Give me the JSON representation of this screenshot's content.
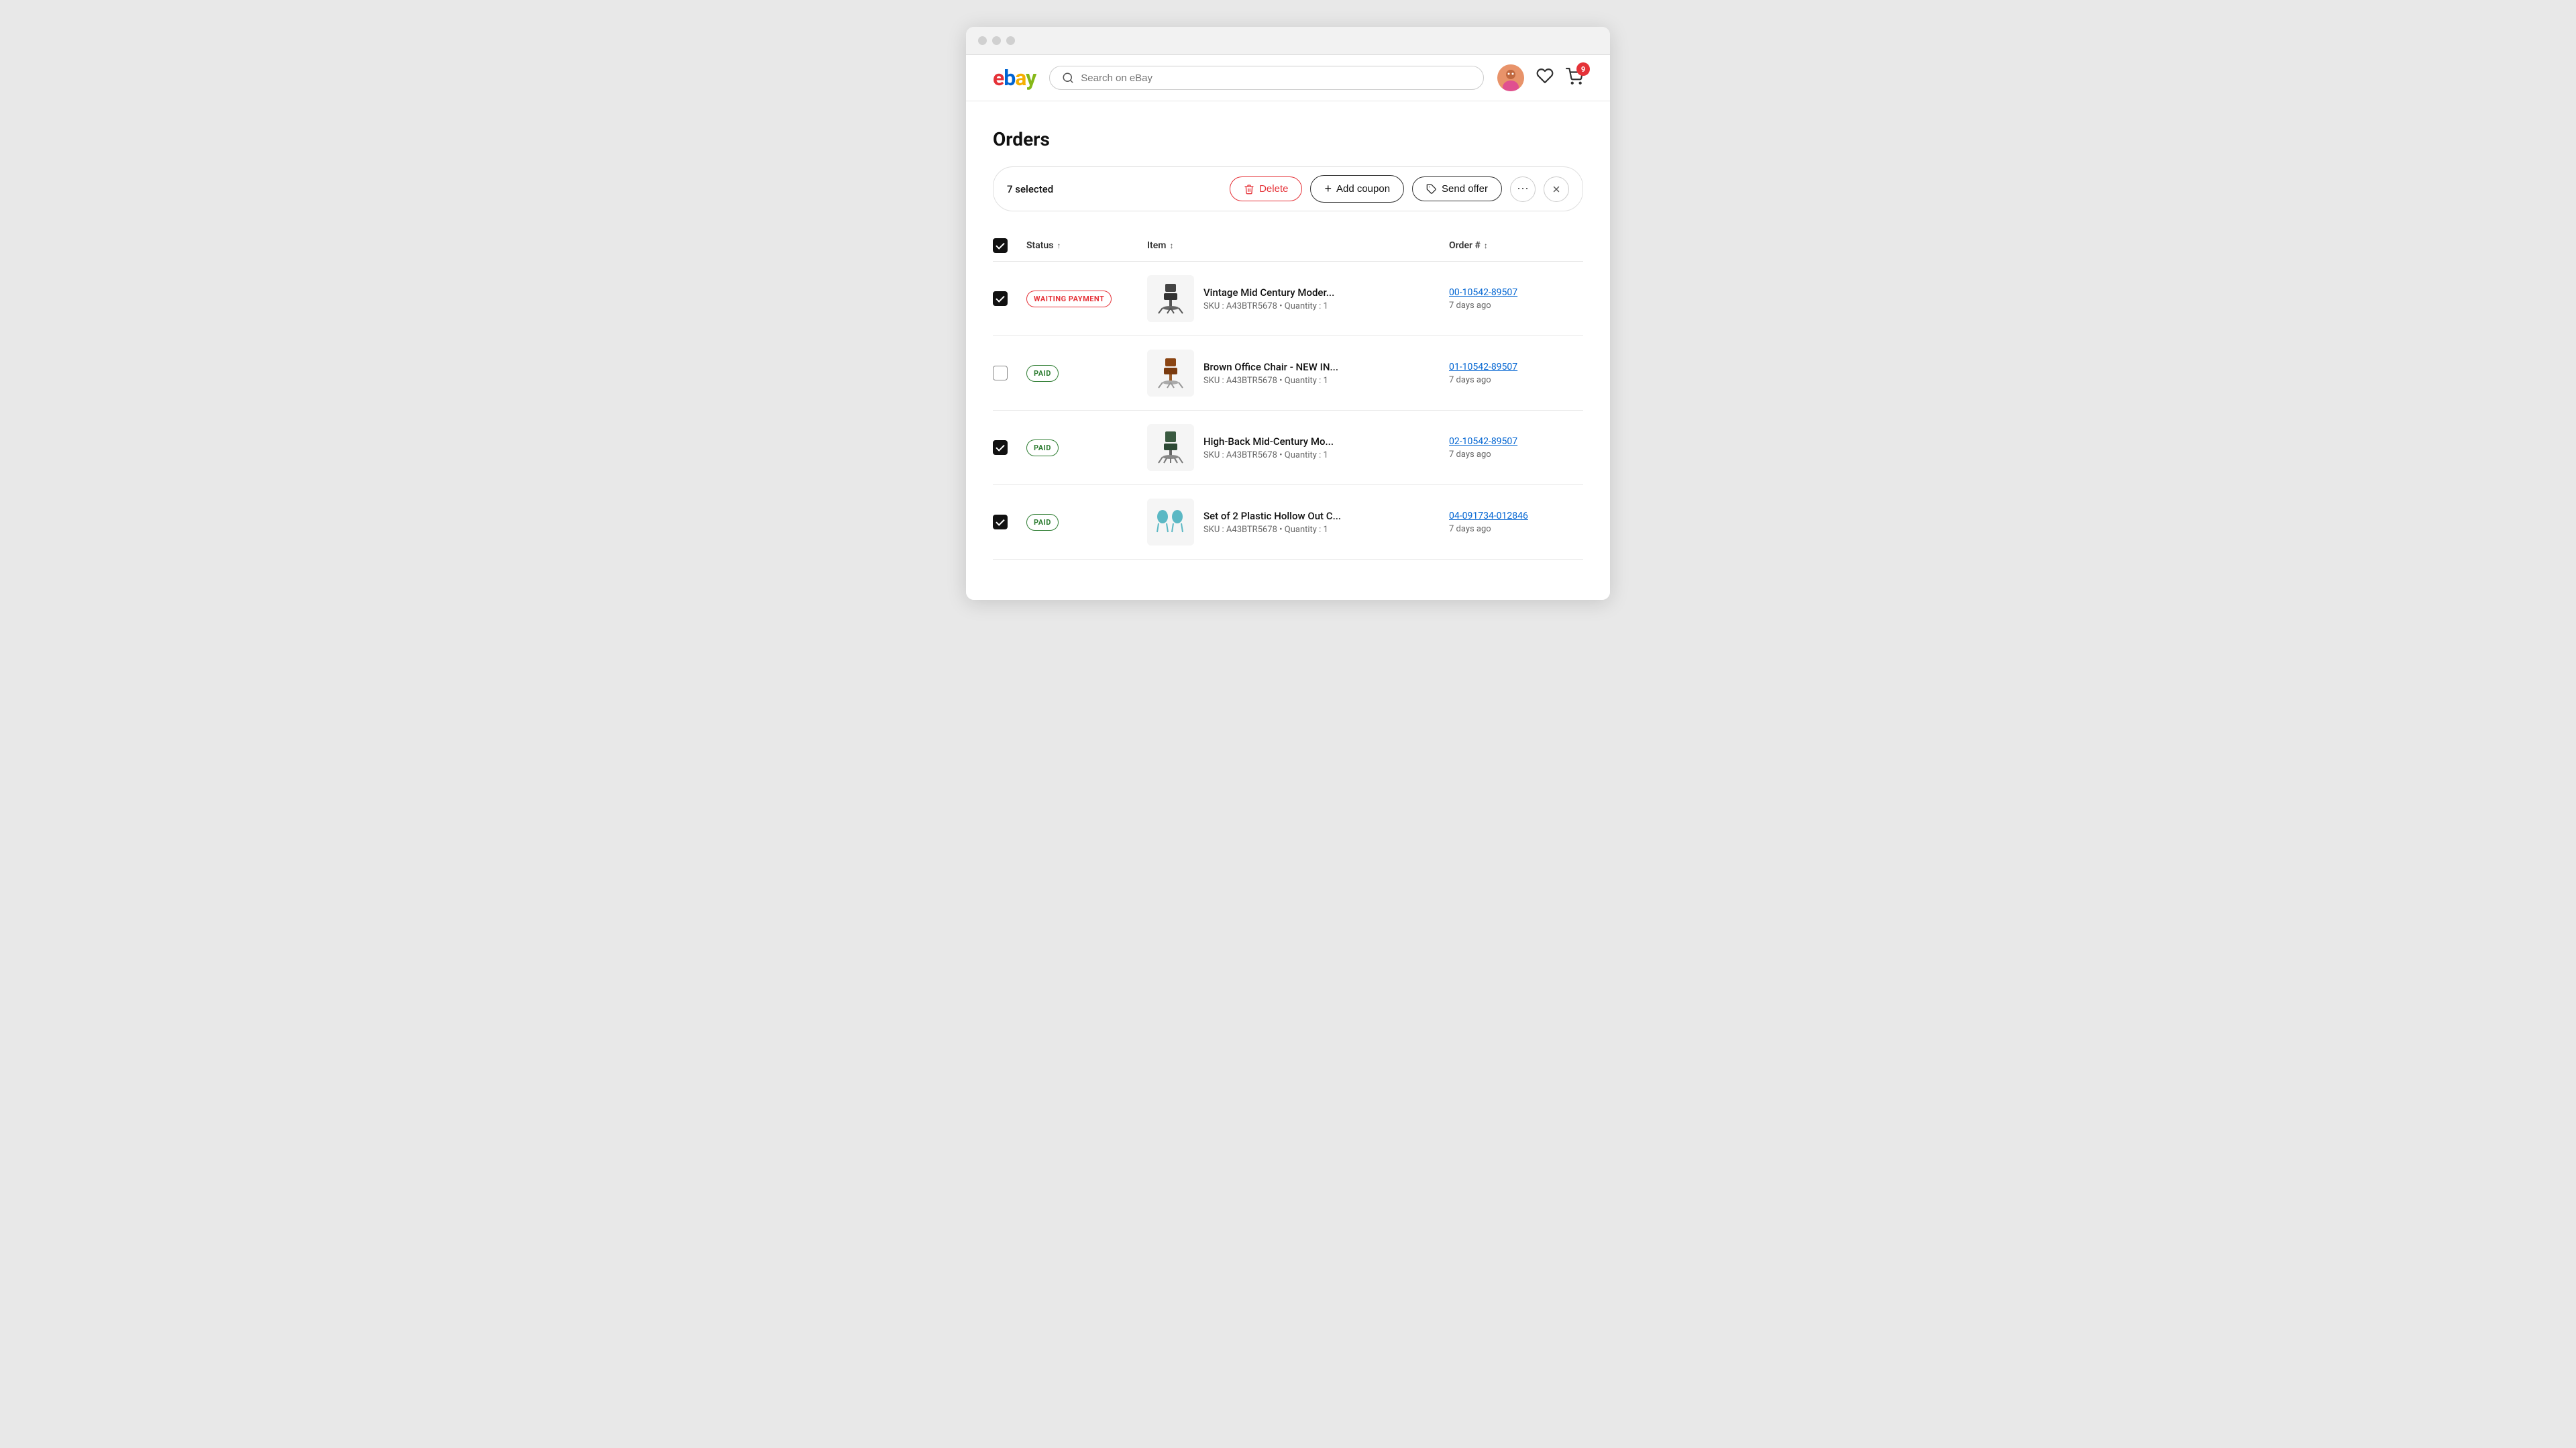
{
  "browser": {
    "dots": [
      "dot1",
      "dot2",
      "dot3"
    ]
  },
  "header": {
    "logo": {
      "e": "e",
      "b": "b",
      "a": "a",
      "y": "y"
    },
    "search": {
      "placeholder": "Search on eBay",
      "value": ""
    },
    "cart_badge": "9"
  },
  "page": {
    "title": "Orders"
  },
  "action_bar": {
    "selected_label": "7 selected",
    "delete_label": "Delete",
    "add_coupon_label": "Add coupon",
    "send_offer_label": "Send offer"
  },
  "table": {
    "columns": {
      "status": "Status",
      "item": "Item",
      "order_num": "Order #"
    },
    "rows": [
      {
        "checked": true,
        "status": "WAITING PAYMENT",
        "status_type": "waiting",
        "item_name": "Vintage Mid Century Moder...",
        "sku": "A43BTR5678",
        "quantity": "1",
        "order_number": "00-10542-89507",
        "time_ago": "7 days ago",
        "chair_type": "black"
      },
      {
        "checked": false,
        "status": "PAID",
        "status_type": "paid",
        "item_name": "Brown Office Chair - NEW IN...",
        "sku": "A43BTR5678",
        "quantity": "1",
        "order_number": "01-10542-89507",
        "time_ago": "7 days ago",
        "chair_type": "brown"
      },
      {
        "checked": true,
        "status": "PAID",
        "status_type": "paid",
        "item_name": "High-Back Mid-Century Mo...",
        "sku": "A43BTR5678",
        "quantity": "1",
        "order_number": "02-10542-89507",
        "time_ago": "7 days ago",
        "chair_type": "green"
      },
      {
        "checked": true,
        "status": "PAID",
        "status_type": "paid",
        "item_name": "Set of 2 Plastic Hollow Out C...",
        "sku": "A43BTR5678",
        "quantity": "1",
        "order_number": "04-091734-012846",
        "time_ago": "7 days ago",
        "chair_type": "teal"
      }
    ]
  }
}
